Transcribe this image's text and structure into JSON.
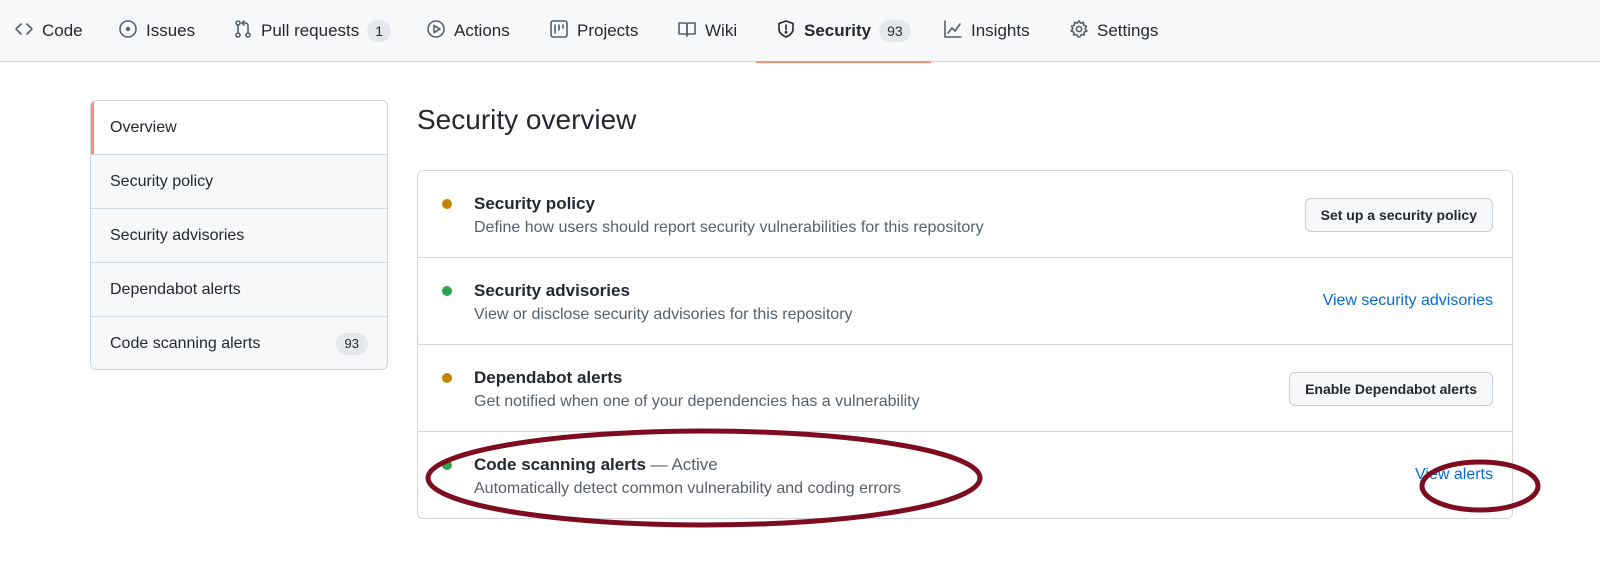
{
  "nav": {
    "tabs": [
      {
        "label": "Code",
        "icon": "code-icon"
      },
      {
        "label": "Issues",
        "icon": "issue-opened-icon"
      },
      {
        "label": "Pull requests",
        "icon": "git-pull-request-icon",
        "count": "1"
      },
      {
        "label": "Actions",
        "icon": "play-icon"
      },
      {
        "label": "Projects",
        "icon": "project-icon"
      },
      {
        "label": "Wiki",
        "icon": "book-icon"
      },
      {
        "label": "Security",
        "icon": "shield-icon",
        "count": "93",
        "selected": true
      },
      {
        "label": "Insights",
        "icon": "graph-icon"
      },
      {
        "label": "Settings",
        "icon": "gear-icon"
      }
    ]
  },
  "sidebar": {
    "items": [
      {
        "label": "Overview",
        "selected": true
      },
      {
        "label": "Security policy"
      },
      {
        "label": "Security advisories"
      },
      {
        "label": "Dependabot alerts"
      },
      {
        "label": "Code scanning alerts",
        "count": "93"
      }
    ]
  },
  "main": {
    "title": "Security overview",
    "rows": [
      {
        "title": "Security policy",
        "status": "",
        "description": "Define how users should report security vulnerabilities for this repository",
        "dot_color": "#bf8700",
        "action_label": "Set up a security policy",
        "action_type": "button"
      },
      {
        "title": "Security advisories",
        "status": "",
        "description": "View or disclose security advisories for this repository",
        "dot_color": "#2da44e",
        "action_label": "View security advisories",
        "action_type": "link"
      },
      {
        "title": "Dependabot alerts",
        "status": "",
        "description": "Get notified when one of your dependencies has a vulnerability",
        "dot_color": "#bf8700",
        "action_label": "Enable Dependabot alerts",
        "action_type": "button"
      },
      {
        "title": "Code scanning alerts",
        "status": " — Active",
        "description": "Automatically detect common vulnerability and coding errors",
        "dot_color": "#2da44e",
        "action_label": "View alerts",
        "action_type": "link"
      }
    ]
  },
  "colors": {
    "accent_underline": "#fd8c73",
    "link": "#0969da",
    "annotation": "#7d0c1f"
  }
}
